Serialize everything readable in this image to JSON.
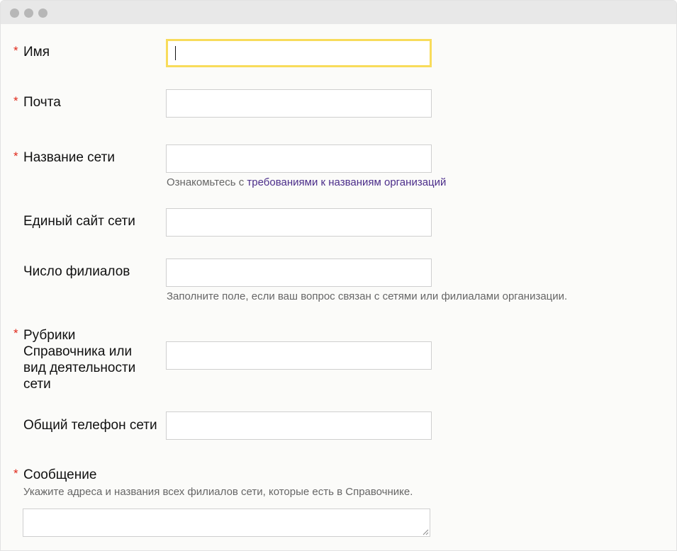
{
  "form": {
    "name": {
      "label": "Имя",
      "required": "*",
      "value": ""
    },
    "email": {
      "label": "Почта",
      "required": "*",
      "value": ""
    },
    "network_name": {
      "label": "Название сети",
      "required": "*",
      "value": "",
      "hint_prefix": "Ознакомьтесь с ",
      "hint_link": "требованиями к названиям организаций"
    },
    "website": {
      "label": "Единый сайт сети",
      "value": ""
    },
    "branches": {
      "label": "Число филиалов",
      "value": "",
      "hint": "Заполните поле, если ваш вопрос связан с сетями или филиалами организации."
    },
    "rubrics": {
      "label_lines": [
        "Рубрики",
        "Справочника или",
        "вид деятельности",
        "сети"
      ],
      "required": "*",
      "value": ""
    },
    "phone": {
      "label": "Общий телефон сети",
      "value": ""
    },
    "message": {
      "label": "Сообщение",
      "required": "*",
      "hint": "Укажите адреса и названия всех филиалов сети, которые есть в Справочнике.",
      "value": ""
    }
  },
  "colors": {
    "required_star": "#e0291b",
    "focus_border": "#f8dc5b",
    "link": "#4b2d8a",
    "hint_text": "#666666"
  }
}
